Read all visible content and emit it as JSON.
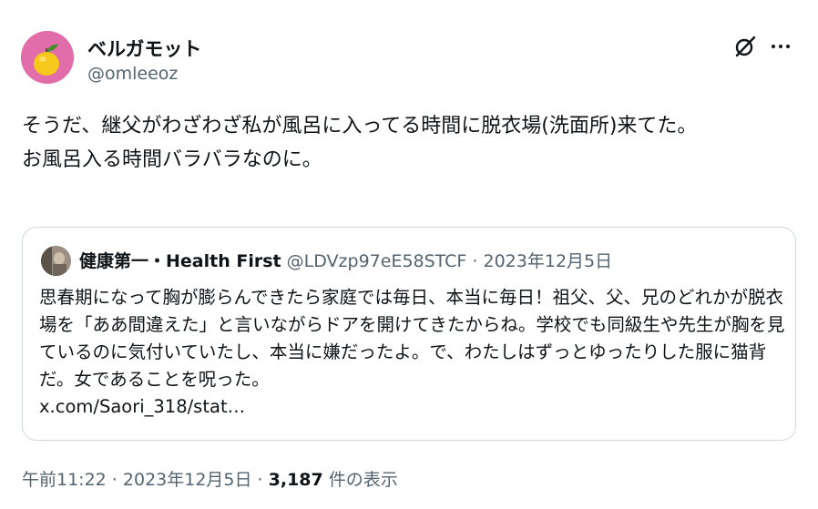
{
  "author": {
    "display_name": "ベルガモット",
    "handle": "@omleeoz"
  },
  "tweet": {
    "text": "そうだ、継父がわざわざ私が風呂に入ってる時間に脱衣場(洗面所)来てた。\nお風呂入る時間バラバラなのに。"
  },
  "quote": {
    "display_name": "健康第一・Health First",
    "handle": "@LDVzp97eE58STCF",
    "separator": " · ",
    "date": "2023年12月5日",
    "text": "思春期になって胸が膨らんできたら家庭では毎日、本当に毎日！祖父、父、兄のどれかが脱衣場を「ああ間違えた」と言いながらドアを開けてきたからね。学校でも同級生や先生が胸を見ているのに気付いていたし、本当に嫌だったよ。で、わたしはずっとゆったりした服に猫背だ。女であることを呪った。",
    "link": "x.com/Saori_318/stat…"
  },
  "footer": {
    "time": "午前11:22",
    "separator": " · ",
    "date": "2023年12月5日",
    "views_count": "3,187",
    "views_label": " 件の表示"
  },
  "icons": {
    "grok": "grok-slash-icon",
    "more": "more-horizontal-icon"
  },
  "colors": {
    "avatar_bg": "#e26dab",
    "text": "#0f1419",
    "secondary_text": "#536471",
    "border": "#cfd9de"
  }
}
